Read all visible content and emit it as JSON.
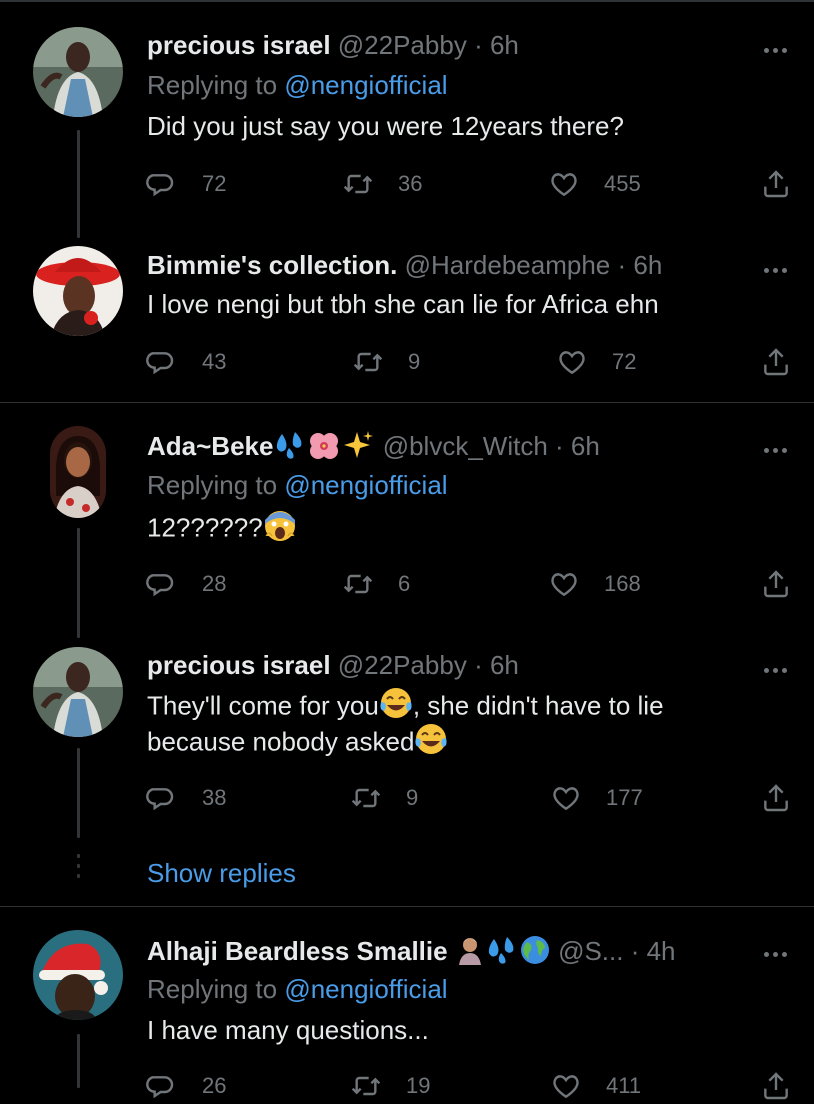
{
  "tweets": [
    {
      "name": "precious israel",
      "handle": "@22Pabby",
      "time": "· 6h",
      "replying_prefix": "Replying to ",
      "replying_to": "@nengiofficial",
      "text": "Did you just say you were 12years there?",
      "replies": "72",
      "retweets": "36",
      "likes": "455"
    },
    {
      "name": "Bimmie's collection.",
      "handle": "@Hardebeamphe",
      "time": "· 6h",
      "text": "I love nengi but tbh she can lie for Africa ehn",
      "replies": "43",
      "retweets": "9",
      "likes": "72"
    },
    {
      "name": "Ada~Beke",
      "handle": "@blvck_Witch",
      "time": "· 6h",
      "replying_prefix": "Replying to ",
      "replying_to": "@nengiofficial",
      "text": "12??????",
      "replies": "28",
      "retweets": "6",
      "likes": "168"
    },
    {
      "name": "precious israel",
      "handle": "@22Pabby",
      "time": "· 6h",
      "text_line1": "They'll come for you",
      "text_line1b": ", she didn't have to lie",
      "text_line2": "because nobody asked",
      "replies": "38",
      "retweets": "9",
      "likes": "177"
    },
    {
      "name": "Alhaji Beardless Smallie",
      "handle": "@S...",
      "time": "· 4h",
      "replying_prefix": "Replying to ",
      "replying_to": "@nengiofficial",
      "text": "I have many questions...",
      "replies": "26",
      "retweets": "19",
      "likes": "411"
    }
  ],
  "show_replies_label": "Show replies",
  "colors": {
    "background": "#000000",
    "link": "#4a9ce8",
    "muted": "#71767b",
    "text": "#e7e9ea",
    "divider": "#2f3336"
  },
  "icons": [
    "reply-icon",
    "retweet-icon",
    "like-icon",
    "share-icon",
    "more-icon"
  ]
}
